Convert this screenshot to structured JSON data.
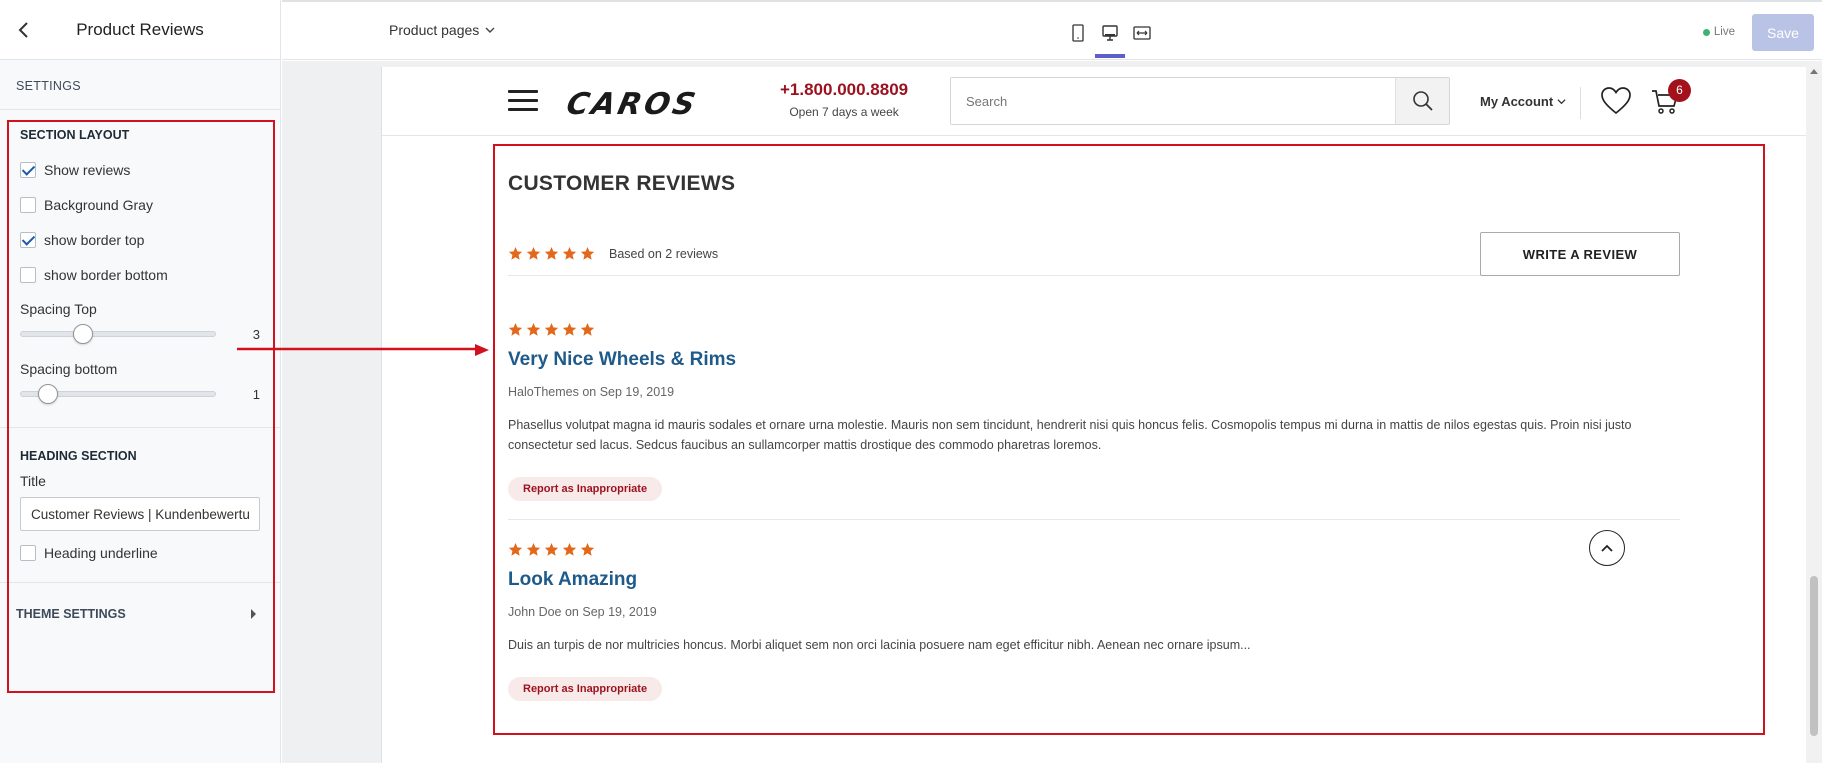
{
  "panel": {
    "title": "Product Reviews",
    "settings_label": "SETTINGS",
    "section_layout": {
      "title": "SECTION LAYOUT",
      "checkboxes": [
        {
          "label": "Show reviews",
          "checked": true
        },
        {
          "label": "Background Gray",
          "checked": false
        },
        {
          "label": "show border top",
          "checked": true
        },
        {
          "label": "show border bottom",
          "checked": false
        }
      ],
      "spacing_top": {
        "label": "Spacing Top",
        "value": "3"
      },
      "spacing_bottom": {
        "label": "Spacing bottom",
        "value": "1"
      }
    },
    "heading_section": {
      "title": "HEADING SECTION",
      "field_label": "Title",
      "field_value": "Customer Reviews | Kundenbewertu",
      "underline_label": "Heading underline",
      "underline_checked": false
    },
    "theme_settings": "THEME SETTINGS"
  },
  "toolbar": {
    "page_select": "Product pages",
    "devices": [
      "mobile-icon",
      "desktop-icon",
      "full-width-icon"
    ],
    "active_device": "desktop",
    "live_label": "Live",
    "save_label": "Save"
  },
  "site": {
    "logo": "CAROS",
    "phone": "+1.800.000.8809",
    "hours": "Open 7 days a week",
    "search_placeholder": "Search",
    "account": "My Account",
    "cart_count": "6"
  },
  "reviews": {
    "heading": "CUSTOMER REVIEWS",
    "rating": 5,
    "based_on": "Based on 2 reviews",
    "write_button": "WRITE A REVIEW",
    "items": [
      {
        "rating": 5,
        "title": "Very Nice Wheels & Rims",
        "meta": "HaloThemes on Sep 19, 2019",
        "body": "Phasellus volutpat magna id mauris sodales et ornare urna molestie. Mauris non sem tincidunt, hendrerit nisi quis honcus felis. Cosmopolis tempus mi durna in mattis de nilos egestas quis. Proin nisi justo consectetur sed lacus. Sedcus faucibus an sullamcorper mattis drostique des commodo pharetras loremos.",
        "report": "Report as Inappropriate"
      },
      {
        "rating": 5,
        "title": "Look Amazing",
        "meta": "John Doe on Sep 19, 2019",
        "body": "Duis an turpis de nor multricies honcus. Morbi aliquet sem non orci lacinia posuere nam eget efficitur nibh. Aenean nec ornare ipsum...",
        "report": "Report as Inappropriate"
      }
    ]
  },
  "colors": {
    "star": "#e2691b",
    "brand_red": "#9b111e",
    "link_blue": "#1e5a8a",
    "annotation_red": "#d0121e",
    "active_tab": "#5b5fc7"
  }
}
